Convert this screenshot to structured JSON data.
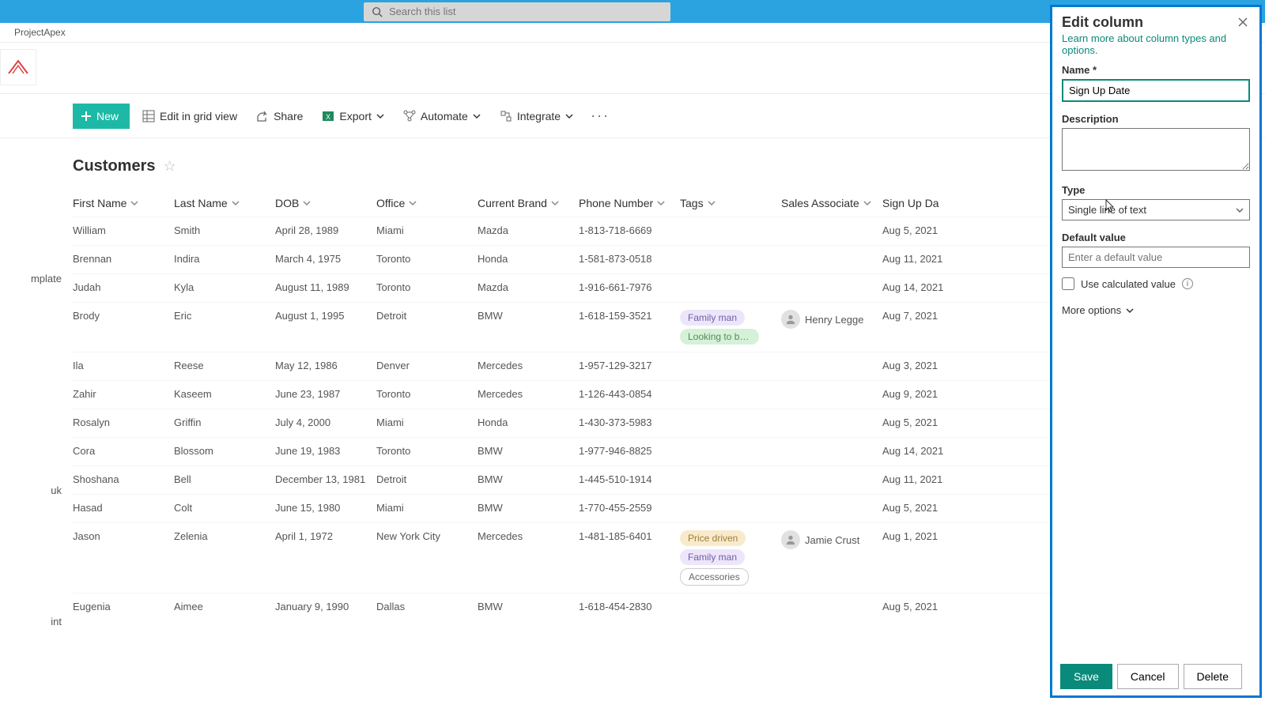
{
  "search": {
    "placeholder": "Search this list"
  },
  "breadcrumb": {
    "site": "ProjectApex"
  },
  "leftNav": {
    "item1": "mplate",
    "item2": "uk",
    "item3": "int"
  },
  "commandBar": {
    "new": "New",
    "editGrid": "Edit in grid view",
    "share": "Share",
    "export": "Export",
    "automate": "Automate",
    "integrate": "Integrate"
  },
  "list": {
    "title": "Customers",
    "columns": {
      "firstName": "First Name",
      "lastName": "Last Name",
      "dob": "DOB",
      "office": "Office",
      "currentBrand": "Current Brand",
      "phone": "Phone Number",
      "tags": "Tags",
      "salesAssociate": "Sales Associate",
      "signUp": "Sign Up Da"
    },
    "rows": [
      {
        "first": "William",
        "last": "Smith",
        "dob": "April 28, 1989",
        "office": "Miami",
        "brand": "Mazda",
        "phone": "1-813-718-6669",
        "tags": [],
        "assoc": "",
        "signup": "Aug 5, 2021"
      },
      {
        "first": "Brennan",
        "last": "Indira",
        "dob": "March 4, 1975",
        "office": "Toronto",
        "brand": "Honda",
        "phone": "1-581-873-0518",
        "tags": [],
        "assoc": "",
        "signup": "Aug 11, 2021"
      },
      {
        "first": "Judah",
        "last": "Kyla",
        "dob": "August 11, 1989",
        "office": "Toronto",
        "brand": "Mazda",
        "phone": "1-916-661-7976",
        "tags": [],
        "assoc": "",
        "signup": "Aug 14, 2021"
      },
      {
        "first": "Brody",
        "last": "Eric",
        "dob": "August 1, 1995",
        "office": "Detroit",
        "brand": "BMW",
        "phone": "1-618-159-3521",
        "tags": [
          {
            "t": "Family man",
            "c": "purple"
          },
          {
            "t": "Looking to buy s...",
            "c": "green"
          }
        ],
        "assoc": "Henry Legge",
        "signup": "Aug 7, 2021"
      },
      {
        "first": "Ila",
        "last": "Reese",
        "dob": "May 12, 1986",
        "office": "Denver",
        "brand": "Mercedes",
        "phone": "1-957-129-3217",
        "tags": [],
        "assoc": "",
        "signup": "Aug 3, 2021"
      },
      {
        "first": "Zahir",
        "last": "Kaseem",
        "dob": "June 23, 1987",
        "office": "Toronto",
        "brand": "Mercedes",
        "phone": "1-126-443-0854",
        "tags": [],
        "assoc": "",
        "signup": "Aug 9, 2021"
      },
      {
        "first": "Rosalyn",
        "last": "Griffin",
        "dob": "July 4, 2000",
        "office": "Miami",
        "brand": "Honda",
        "phone": "1-430-373-5983",
        "tags": [],
        "assoc": "",
        "signup": "Aug 5, 2021"
      },
      {
        "first": "Cora",
        "last": "Blossom",
        "dob": "June 19, 1983",
        "office": "Toronto",
        "brand": "BMW",
        "phone": "1-977-946-8825",
        "tags": [],
        "assoc": "",
        "signup": "Aug 14, 2021"
      },
      {
        "first": "Shoshana",
        "last": "Bell",
        "dob": "December 13, 1981",
        "office": "Detroit",
        "brand": "BMW",
        "phone": "1-445-510-1914",
        "tags": [],
        "assoc": "",
        "signup": "Aug 11, 2021"
      },
      {
        "first": "Hasad",
        "last": "Colt",
        "dob": "June 15, 1980",
        "office": "Miami",
        "brand": "BMW",
        "phone": "1-770-455-2559",
        "tags": [],
        "assoc": "",
        "signup": "Aug 5, 2021"
      },
      {
        "first": "Jason",
        "last": "Zelenia",
        "dob": "April 1, 1972",
        "office": "New York City",
        "brand": "Mercedes",
        "phone": "1-481-185-6401",
        "tags": [
          {
            "t": "Price driven",
            "c": "yellow"
          },
          {
            "t": "Family man",
            "c": "purple"
          },
          {
            "t": "Accessories",
            "c": "hollow"
          }
        ],
        "assoc": "Jamie Crust",
        "signup": "Aug 1, 2021"
      },
      {
        "first": "Eugenia",
        "last": "Aimee",
        "dob": "January 9, 1990",
        "office": "Dallas",
        "brand": "BMW",
        "phone": "1-618-454-2830",
        "tags": [],
        "assoc": "",
        "signup": "Aug 5, 2021"
      }
    ]
  },
  "panel": {
    "title": "Edit column",
    "learnMore": "Learn more about column types and options.",
    "nameLabel": "Name *",
    "nameValue": "Sign Up Date",
    "descLabel": "Description",
    "typeLabel": "Type",
    "typeValue": "Single line of text",
    "defaultLabel": "Default value",
    "defaultPlaceholder": "Enter a default value",
    "useCalc": "Use calculated value",
    "moreOptions": "More options",
    "save": "Save",
    "cancel": "Cancel",
    "delete": "Delete"
  }
}
